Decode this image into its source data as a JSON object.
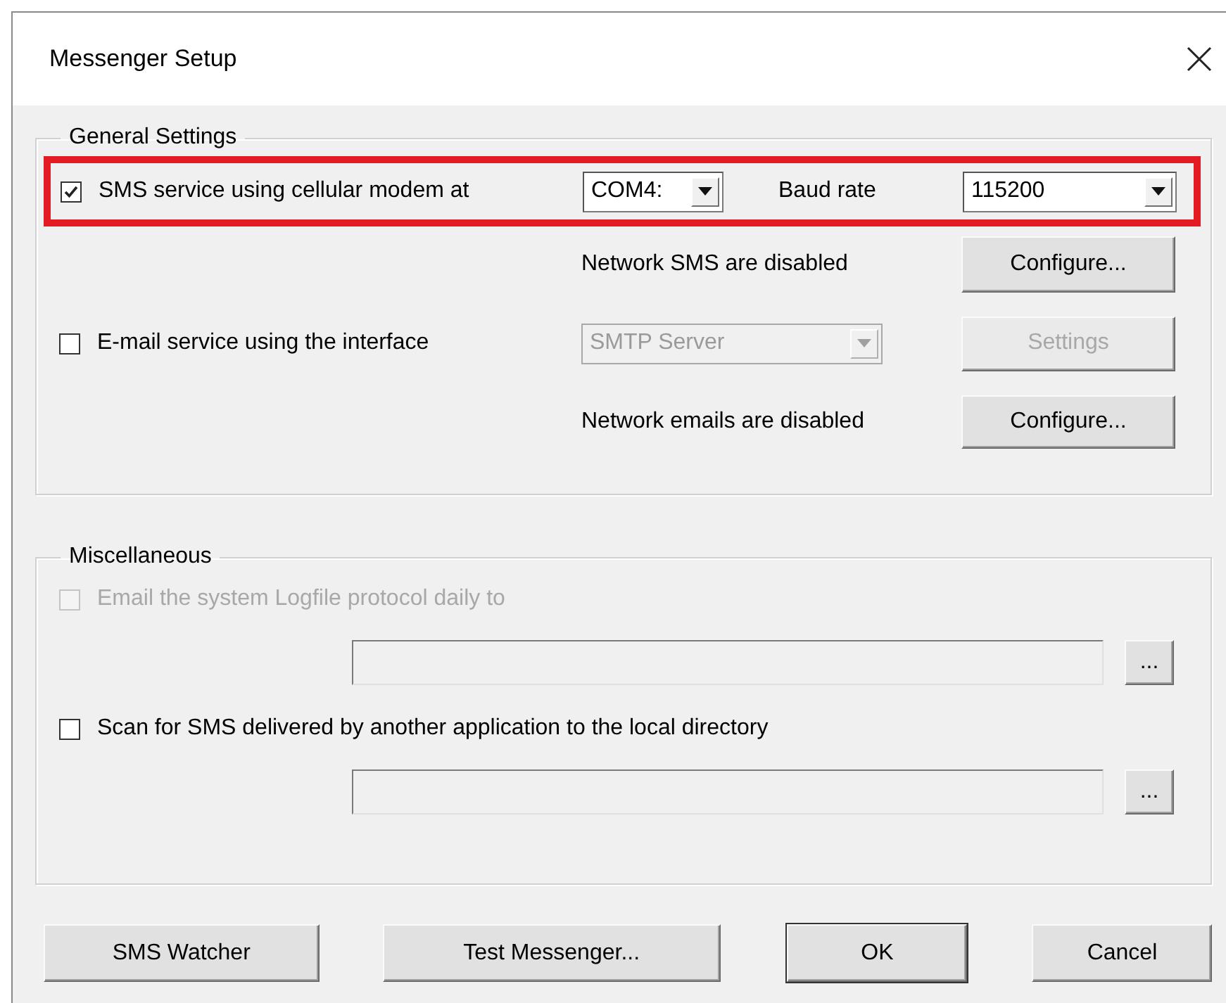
{
  "window": {
    "title": "Messenger Setup"
  },
  "general_settings": {
    "title": "General Settings",
    "sms": {
      "label": "SMS service using cellular modem at",
      "checked": true,
      "highlighted": true,
      "port": {
        "value": "COM4:"
      },
      "baud_label": "Baud rate",
      "baud": {
        "value": "115200"
      }
    },
    "network_sms": {
      "status": "Network SMS are disabled",
      "button": "Configure..."
    },
    "email": {
      "label": "E-mail service using the interface",
      "checked": false,
      "server": {
        "value": "SMTP Server",
        "disabled": true
      },
      "settings_button": {
        "label": "Settings",
        "disabled": true
      }
    },
    "network_email": {
      "status": "Network emails are disabled",
      "button": "Configure..."
    }
  },
  "miscellaneous": {
    "title": "Miscellaneous",
    "items": [
      {
        "label": "Email the system Logfile protocol daily to",
        "checked": false,
        "disabled": true,
        "browse": "..."
      },
      {
        "label": "Scan for SMS delivered by another application to the local directory",
        "checked": false,
        "disabled": false,
        "browse": "..."
      }
    ]
  },
  "buttons": [
    {
      "label": "SMS Watcher",
      "default": false
    },
    {
      "label": "Test Messenger...",
      "default": false
    },
    {
      "label": "OK",
      "default": true
    },
    {
      "label": "Cancel",
      "default": false
    }
  ]
}
